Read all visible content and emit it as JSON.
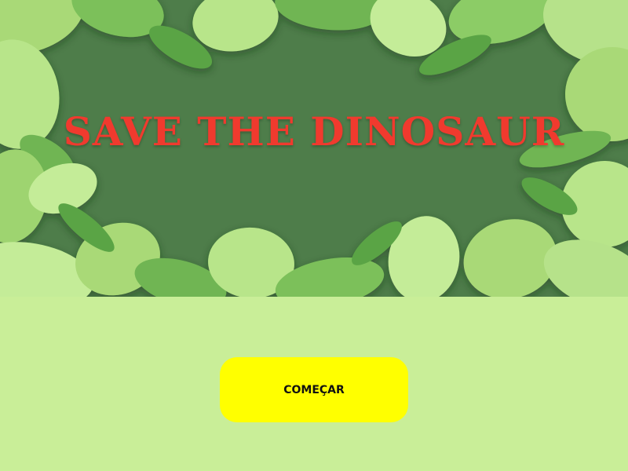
{
  "banner": {
    "title": "SAVE THE DINOSAUR",
    "image": "jungle-leaves-frame"
  },
  "start_button": {
    "label": "COMEÇAR"
  },
  "colors": {
    "page_background": "#c9ee98",
    "banner_background": "#4e7d4a",
    "title": "#f03a2e",
    "button_background": "#ffff00",
    "button_text": "#111111"
  }
}
